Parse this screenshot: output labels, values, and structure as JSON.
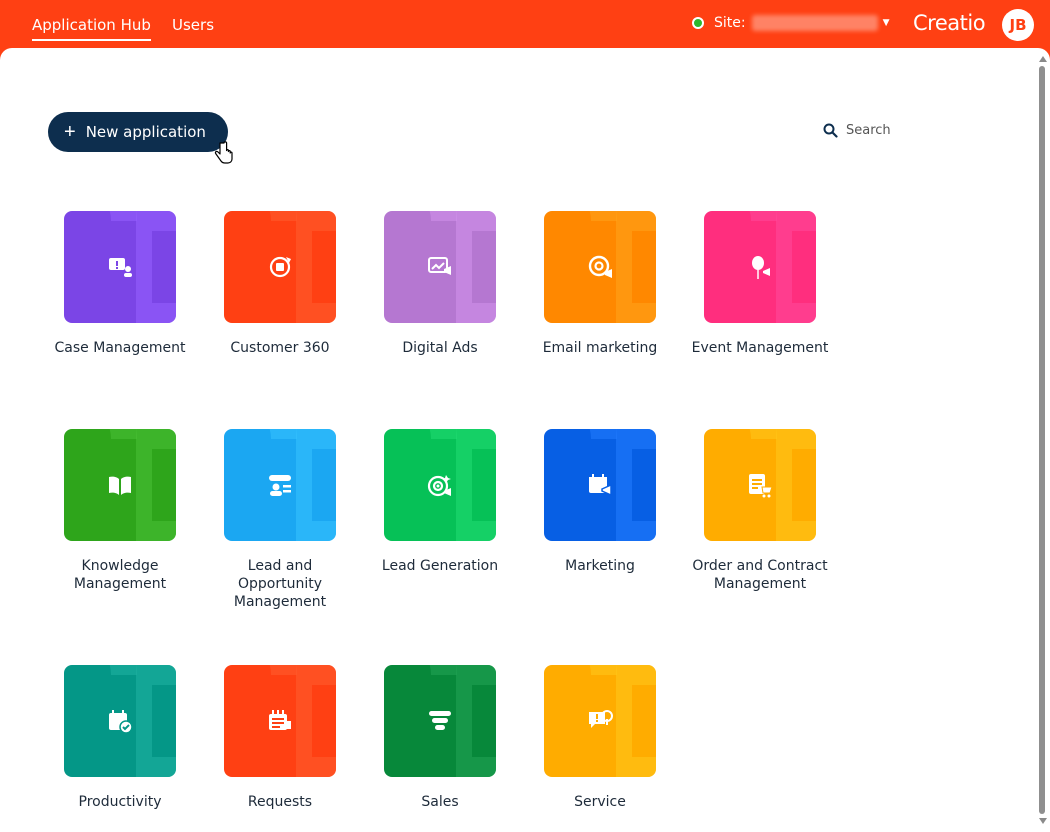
{
  "nav": {
    "tabs": [
      {
        "label": "Application Hub",
        "active": true
      },
      {
        "label": "Users",
        "active": false
      }
    ]
  },
  "site": {
    "label": "Site:",
    "status_color": "#2eb82e"
  },
  "brand": {
    "logo_text": "Creatio",
    "avatar_initials": "JB",
    "accent": "#ff4013"
  },
  "toolbar": {
    "new_app_label": "New application",
    "search_placeholder": "Search",
    "button_color": "#0d2e4e"
  },
  "apps": [
    {
      "label": "Case Management",
      "color": "#7b45e6",
      "icon": "case-icon"
    },
    {
      "label": "Customer 360",
      "color": "#ff4013",
      "icon": "customer-icon"
    },
    {
      "label": "Digital Ads",
      "color": "#b577d1",
      "icon": "digital-ads-icon"
    },
    {
      "label": "Email marketing",
      "color": "#ff8800",
      "icon": "email-icon"
    },
    {
      "label": "Event Management",
      "color": "#ff2e7e",
      "icon": "event-icon"
    },
    {
      "label": "Knowledge Management",
      "color": "#2ea51b",
      "icon": "book-icon"
    },
    {
      "label": "Lead and Opportunity Management",
      "color": "#1ba7f2",
      "icon": "lead-icon"
    },
    {
      "label": "Lead Generation",
      "color": "#06c157",
      "icon": "target-icon"
    },
    {
      "label": "Marketing",
      "color": "#075fe4",
      "icon": "marketing-icon"
    },
    {
      "label": "Order and Contract Management",
      "color": "#ffac00",
      "icon": "order-icon"
    },
    {
      "label": "Productivity",
      "color": "#049787",
      "icon": "calendar-check-icon"
    },
    {
      "label": "Requests",
      "color": "#ff4013",
      "icon": "requests-icon"
    },
    {
      "label": "Sales",
      "color": "#07883a",
      "icon": "funnel-icon"
    },
    {
      "label": "Service",
      "color": "#ffac00",
      "icon": "service-icon"
    }
  ]
}
